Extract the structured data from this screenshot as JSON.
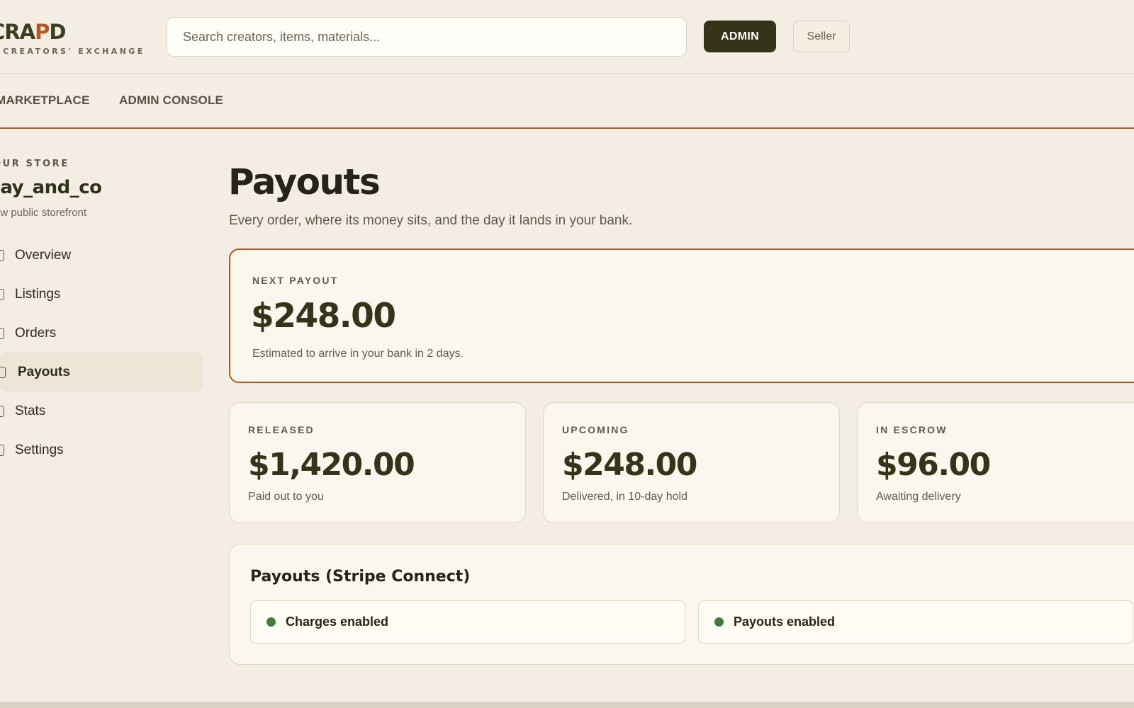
{
  "header": {
    "logo_text": "CRAPD",
    "logo_prefix": "CRA",
    "logo_accent": "P",
    "logo_suffix": "D",
    "logo_tagline": "E CREATORS' EXCHANGE",
    "search_placeholder": "Search creators, items, materials...",
    "admin_button": "ADMIN",
    "seller_button": "Seller"
  },
  "nav": {
    "items": [
      {
        "label": "MARKETPLACE"
      },
      {
        "label": "ADMIN CONSOLE"
      }
    ]
  },
  "sidebar": {
    "section_label": "OUR STORE",
    "store_name": "lay_and_co",
    "storefront_link": "ew public storefront",
    "items": [
      {
        "label": "Overview"
      },
      {
        "label": "Listings"
      },
      {
        "label": "Orders"
      },
      {
        "label": "Payouts",
        "active": true
      },
      {
        "label": "Stats"
      },
      {
        "label": "Settings"
      }
    ]
  },
  "main": {
    "title": "Payouts",
    "subtitle": "Every order, where its money sits, and the day it lands in your bank.",
    "next_payout": {
      "label": "NEXT PAYOUT",
      "amount": "$248.00",
      "note": "Estimated to arrive in your bank in 2 days."
    },
    "stats": [
      {
        "label": "RELEASED",
        "amount": "$1,420.00",
        "note": "Paid out to you"
      },
      {
        "label": "UPCOMING",
        "amount": "$248.00",
        "note": "Delivered, in 10-day hold"
      },
      {
        "label": "IN ESCROW",
        "amount": "$96.00",
        "note": "Awaiting delivery"
      }
    ],
    "stripe": {
      "title": "Payouts (Stripe Connect)",
      "statuses": [
        {
          "label": "Charges enabled",
          "status": "enabled"
        },
        {
          "label": "Payouts enabled",
          "status": "enabled"
        }
      ]
    }
  },
  "colors": {
    "background": "#f4ede3",
    "accent": "#b35a24",
    "brand_dark": "#343419",
    "status_green": "#3f7d3c"
  }
}
